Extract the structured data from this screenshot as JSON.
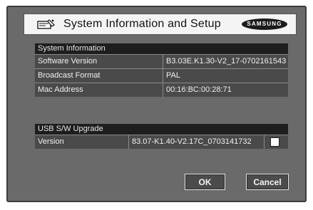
{
  "header": {
    "title": "System Information and Setup",
    "icon": "remote-control-icon",
    "logo_text": "SAMSUNG"
  },
  "system_info": {
    "heading": "System Information",
    "rows": [
      {
        "label": "Software Version",
        "value": "B3.03E.K1.30-V2_17-0702161543"
      },
      {
        "label": "Broadcast Format",
        "value": "PAL"
      },
      {
        "label": "Mac Address",
        "value": "00:16:BC:00:28:71"
      }
    ]
  },
  "usb_upgrade": {
    "heading": "USB S/W Upgrade",
    "version_label": "Version",
    "version_value": "83.07-K1.40-V2.17C_0703141732",
    "checkbox_checked": false
  },
  "buttons": {
    "ok_label": "OK",
    "cancel_label": "Cancel"
  },
  "colors": {
    "panel": "#6a6a6a",
    "header_bar": "#1e1e1e",
    "row": "#4a4a4a"
  }
}
